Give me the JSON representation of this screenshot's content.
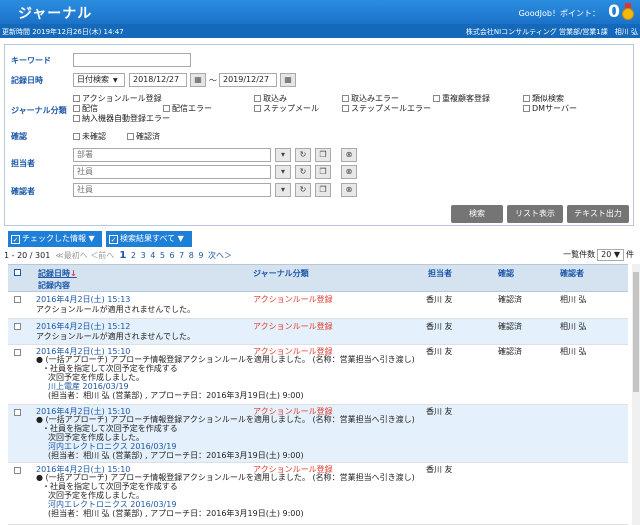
{
  "header": {
    "title": "ジャーナル",
    "goodjob": "GoodJob！ポイント：",
    "points": "0",
    "updated": "更新時間 2019年12月26日(木) 14:47",
    "org": "株式会社NIコンサルティング 営業部/営業1課　相川 弘"
  },
  "search": {
    "keyword_label": "キーワード",
    "date_label": "記録日時",
    "date_mode": "日付検索",
    "date_from": "2018/12/27",
    "tilde": "～",
    "date_to": "2019/12/27",
    "category_label": "ジャーナル分類",
    "categories": [
      "アクションルール登録",
      "取込み",
      "取込みエラー",
      "重複顧客登録",
      "類似検索",
      "配信",
      "配信エラー",
      "ステップメール",
      "ステップメールエラー",
      "DMサーバー",
      "納入機器自動登録エラー"
    ],
    "confirm_label": "確認",
    "confirm_options": [
      "未確認",
      "確認済"
    ],
    "assignee_label": "担当者",
    "dept_placeholder": "部署",
    "employee_placeholder": "社員",
    "confirmer_label": "確認者",
    "confirmer_placeholder": "社員",
    "btn_search": "検索",
    "btn_list": "リスト表示",
    "btn_text": "テキスト出力"
  },
  "toolbar": {
    "checked_info": "チェックした情報",
    "all_results": "検索結果すべて"
  },
  "pager": {
    "range": "1 - 20 / 301",
    "first": "≪最初へ",
    "prev": "＜前へ",
    "current": "1",
    "pages": [
      "2",
      "3",
      "4",
      "5",
      "6",
      "7",
      "8",
      "9"
    ],
    "next": "次へ＞",
    "per_page_label": "一覧件数",
    "per_page": "20",
    "unit": "件"
  },
  "table": {
    "headers": {
      "date": "記録日時",
      "content": "記録内容",
      "category": "ジャーナル分類",
      "assignee": "担当者",
      "confirm": "確認",
      "confirmer": "確認者"
    },
    "rows": [
      {
        "date": "2016年4月2日(土) 15:13",
        "category": "アクションルール登録",
        "assignee": "香川 友",
        "confirm": "確認済",
        "confirmer": "相川 弘",
        "lines": [
          "アクションルールが適用されませんでした。"
        ]
      },
      {
        "date": "2016年4月2日(土) 15:12",
        "category": "アクションルール登録",
        "assignee": "香川 友",
        "confirm": "確認済",
        "confirmer": "相川 弘",
        "lines": [
          "アクションルールが適用されませんでした。"
        ]
      },
      {
        "date": "2016年4月2日(土) 15:10",
        "category": "アクションルール登録",
        "assignee": "香川 友",
        "confirm": "確認済",
        "confirmer": "相川 弘",
        "lines": [
          "● (一括アプローチ) アプローチ情報登録アクションルールを適用しました。 (名称：営業担当へ引き渡し)",
          "・社員を指定して次回予定を作成する",
          "次回予定を作成しました。",
          "川上電産 2016/03/19",
          "(担当者：相川 弘 (営業部) , アプローチ日：2016年3月19日(土) 9:00)"
        ]
      },
      {
        "date": "2016年4月2日(土) 15:10",
        "category": "アクションルール登録",
        "assignee": "香川 友",
        "confirm": "",
        "confirmer": "",
        "lines": [
          "● (一括アプローチ) アプローチ情報登録アクションルールを適用しました。 (名称：営業担当へ引き渡し)",
          "・社員を指定して次回予定を作成する",
          "次回予定を作成しました。",
          "河内エレクトロニクス 2016/03/19",
          "(担当者：相川 弘 (営業部) , アプローチ日：2016年3月19日(土) 9:00)"
        ]
      },
      {
        "date": "2016年4月2日(土) 15:10",
        "category": "アクションルール登録",
        "assignee": "香川 友",
        "confirm": "",
        "confirmer": "",
        "lines": [
          "● (一括アプローチ) アプローチ情報登録アクションルールを適用しました。 (名称：営業担当へ引き渡し)",
          "・社員を指定して次回予定を作成する",
          "次回予定を作成しました。",
          "河内エレクトロニクス 2016/03/19",
          "(担当者：相川 弘 (営業部) , アプローチ日：2016年3月19日(土) 9:00)"
        ]
      }
    ]
  },
  "icons": {
    "calendar": "calendar-icon",
    "dropdown": "chevron-down-icon",
    "reset": "reset-icon",
    "copy": "copy-icon",
    "clear": "clear-icon",
    "medal": "medal-icon",
    "sort": "sort-down-icon"
  },
  "colors": {
    "header": "#1b72c9",
    "link": "#1c57a8",
    "category": "#e2372b",
    "alt_row": "#e4f0fb"
  }
}
